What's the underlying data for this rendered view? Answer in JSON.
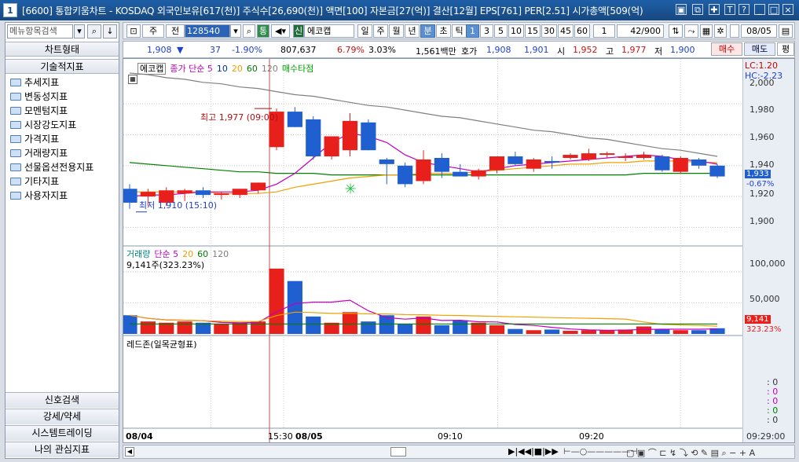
{
  "window": {
    "number": "1",
    "title": "[6600] 통합키움차트 - KOSDAQ 외국인보유[617(천)] 주식수[26,690(천)] 액면[100] 자본금[27(억)] 결산[12월] EPS[761] PER[2.51] 시가총액[509(억)"
  },
  "left": {
    "search_placeholder": "메뉴항목검색",
    "header": "차트형태",
    "section": "기술적지표",
    "items": [
      "추세지표",
      "변동성지표",
      "모멘텀지표",
      "시장강도지표",
      "가격지표",
      "거래량지표",
      "선물옵션전용지표",
      "기타지표",
      "사용자지표"
    ],
    "bottom_tabs": [
      "신호검색",
      "강세/약세",
      "시스템트레이딩",
      "나의 관심지표"
    ]
  },
  "toolbar": {
    "period_type": "주",
    "jeon": "전",
    "code": "128540",
    "tong": "통",
    "sin": "신",
    "stock_name": "에코캡",
    "periods": [
      "일",
      "주",
      "월",
      "년",
      "분",
      "초",
      "틱"
    ],
    "active_period": "분",
    "intervals": [
      "1",
      "3",
      "5",
      "10",
      "15",
      "30",
      "45",
      "60"
    ],
    "active_interval": "1",
    "interval_select": "1",
    "count": "42/900",
    "date": "08/05"
  },
  "quote": {
    "price": "1,908",
    "change": "37",
    "change_pct": "-1.90%",
    "volume": "807,637",
    "vol_pct": "6.79%",
    "other_pct": "3.03%",
    "amount": "1,561백만",
    "hoga_label": "호가",
    "bid": "1,908",
    "ask": "1,901",
    "open_label": "시",
    "open": "1,952",
    "high_label": "고",
    "high": "1,977",
    "low_label": "저",
    "low": "1,900",
    "buy": "매수",
    "sell": "매도",
    "flat": "평"
  },
  "chart": {
    "price_panel_title": [
      "에코캡",
      "종가 단순 5",
      "10",
      "20",
      "60",
      "120",
      "매수타점"
    ],
    "high_note": "최고 1,977 (09:00)",
    "low_note": "최저 1,910 (15:10)",
    "lc": "LC:1.20",
    "hc": "HC:-2.23",
    "price_ticks": [
      "1,980",
      "1,960",
      "1,940",
      "1,920",
      "1,900"
    ],
    "price_top_tick": "2,000",
    "current_price": "1,933",
    "current_pct": "-0.67%",
    "volume_title": [
      "거래량",
      "단순 5",
      "20",
      "60",
      "120"
    ],
    "volume_note": "9,141주(323.23%)",
    "volume_ticks": [
      "100,000",
      "50,000"
    ],
    "volume_current": "9,141",
    "volume_pct": "323.23%",
    "indicator_title": "레드존(일목균형표)",
    "indicator_values": [
      ": 0",
      ": 0",
      ": 0",
      ": 0",
      ": 0"
    ],
    "x_labels": [
      "08/04",
      "15:30",
      "08/05",
      "09:10",
      "09:20",
      "09:29:00"
    ],
    "colors": {
      "up": "#e8201c",
      "down": "#1f5fd0",
      "ma5": "#c000c0",
      "ma10": "#0030a0",
      "ma20": "#f0a000",
      "ma60": "#008000",
      "ma120": "#808080"
    }
  },
  "chart_data": {
    "type": "candlestick",
    "title": "에코캡",
    "candles": [
      {
        "o": 1925,
        "h": 1928,
        "l": 1912,
        "c": 1916
      },
      {
        "o": 1920,
        "h": 1925,
        "l": 1914,
        "c": 1923
      },
      {
        "o": 1916,
        "h": 1926,
        "l": 1914,
        "c": 1924
      },
      {
        "o": 1922,
        "h": 1925,
        "l": 1917,
        "c": 1924
      },
      {
        "o": 1924,
        "h": 1926,
        "l": 1919,
        "c": 1921
      },
      {
        "o": 1921,
        "h": 1923,
        "l": 1918,
        "c": 1922
      },
      {
        "o": 1921,
        "h": 1924,
        "l": 1919,
        "c": 1925
      },
      {
        "o": 1924,
        "h": 1929,
        "l": 1922,
        "c": 1929
      },
      {
        "o": 1952,
        "h": 1977,
        "l": 1950,
        "c": 1975
      },
      {
        "o": 1975,
        "h": 1978,
        "l": 1965,
        "c": 1965
      },
      {
        "o": 1970,
        "h": 1972,
        "l": 1944,
        "c": 1946
      },
      {
        "o": 1946,
        "h": 1958,
        "l": 1944,
        "c": 1959
      },
      {
        "o": 1950,
        "h": 1974,
        "l": 1946,
        "c": 1969
      },
      {
        "o": 1968,
        "h": 1970,
        "l": 1950,
        "c": 1950
      },
      {
        "o": 1944,
        "h": 1945,
        "l": 1928,
        "c": 1941
      },
      {
        "o": 1940,
        "h": 1942,
        "l": 1926,
        "c": 1928
      },
      {
        "o": 1930,
        "h": 1950,
        "l": 1928,
        "c": 1944
      },
      {
        "o": 1945,
        "h": 1948,
        "l": 1932,
        "c": 1936
      },
      {
        "o": 1936,
        "h": 1941,
        "l": 1933,
        "c": 1933
      },
      {
        "o": 1933,
        "h": 1938,
        "l": 1931,
        "c": 1937
      },
      {
        "o": 1937,
        "h": 1946,
        "l": 1935,
        "c": 1946
      },
      {
        "o": 1946,
        "h": 1949,
        "l": 1940,
        "c": 1941
      },
      {
        "o": 1938,
        "h": 1945,
        "l": 1936,
        "c": 1944
      },
      {
        "o": 1943,
        "h": 1946,
        "l": 1938,
        "c": 1942
      },
      {
        "o": 1945,
        "h": 1948,
        "l": 1944,
        "c": 1947
      },
      {
        "o": 1944,
        "h": 1951,
        "l": 1943,
        "c": 1948
      },
      {
        "o": 1947,
        "h": 1949,
        "l": 1945,
        "c": 1948
      },
      {
        "o": 1945,
        "h": 1948,
        "l": 1943,
        "c": 1946
      },
      {
        "o": 1945,
        "h": 1949,
        "l": 1944,
        "c": 1947
      },
      {
        "o": 1946,
        "h": 1947,
        "l": 1936,
        "c": 1937
      },
      {
        "o": 1936,
        "h": 1946,
        "l": 1935,
        "c": 1945
      },
      {
        "o": 1944,
        "h": 1945,
        "l": 1938,
        "c": 1940
      },
      {
        "o": 1940,
        "h": 1941,
        "l": 1932,
        "c": 1933
      }
    ],
    "volumes": [
      30000,
      20000,
      18000,
      20000,
      18000,
      16000,
      18000,
      20000,
      105000,
      85000,
      28000,
      18000,
      35000,
      20000,
      30000,
      16000,
      28000,
      14000,
      22000,
      18000,
      14000,
      8000,
      6000,
      7000,
      5000,
      6000,
      6000,
      7000,
      12000,
      7000,
      6000,
      6000,
      9141
    ],
    "ma": {
      "ma5": [
        1920,
        1921,
        1921,
        1922,
        1923,
        1923,
        1923,
        1924,
        1928,
        1935,
        1945,
        1955,
        1961,
        1959,
        1955,
        1947,
        1942,
        1940,
        1938,
        1936,
        1938,
        1940,
        1941,
        1942,
        1943,
        1944,
        1945,
        1946,
        1947,
        1946,
        1944,
        1943,
        1941
      ],
      "ma20": [
        1923,
        1923,
        1923,
        1923,
        1923,
        1922,
        1922,
        1922,
        1923,
        1926,
        1928,
        1930,
        1932,
        1933,
        1934,
        1934,
        1935,
        1935,
        1935,
        1936,
        1937,
        1938,
        1939,
        1940,
        1941,
        1941,
        1942,
        1942,
        1943,
        1943,
        1943,
        1942,
        1942
      ],
      "ma60": [
        1942,
        1941,
        1940,
        1939,
        1938,
        1937,
        1936,
        1936,
        1935,
        1935,
        1935,
        1934,
        1934,
        1934,
        1934,
        1934,
        1934,
        1934,
        1934,
        1934,
        1934,
        1934,
        1934,
        1934,
        1934,
        1934,
        1934,
        1934,
        1935,
        1935,
        1935,
        1935,
        1935
      ],
      "ma120": [
        2000,
        1999,
        1997,
        1996,
        1994,
        1993,
        1991,
        1990,
        1988,
        1986,
        1985,
        1983,
        1981,
        1979,
        1978,
        1976,
        1974,
        1972,
        1971,
        1969,
        1967,
        1965,
        1963,
        1962,
        1960,
        1958,
        1957,
        1955,
        1953,
        1951,
        1950,
        1948,
        1946
      ]
    },
    "ylim": [
      1890,
      2000
    ],
    "vol_ylim": [
      0,
      120000
    ]
  }
}
